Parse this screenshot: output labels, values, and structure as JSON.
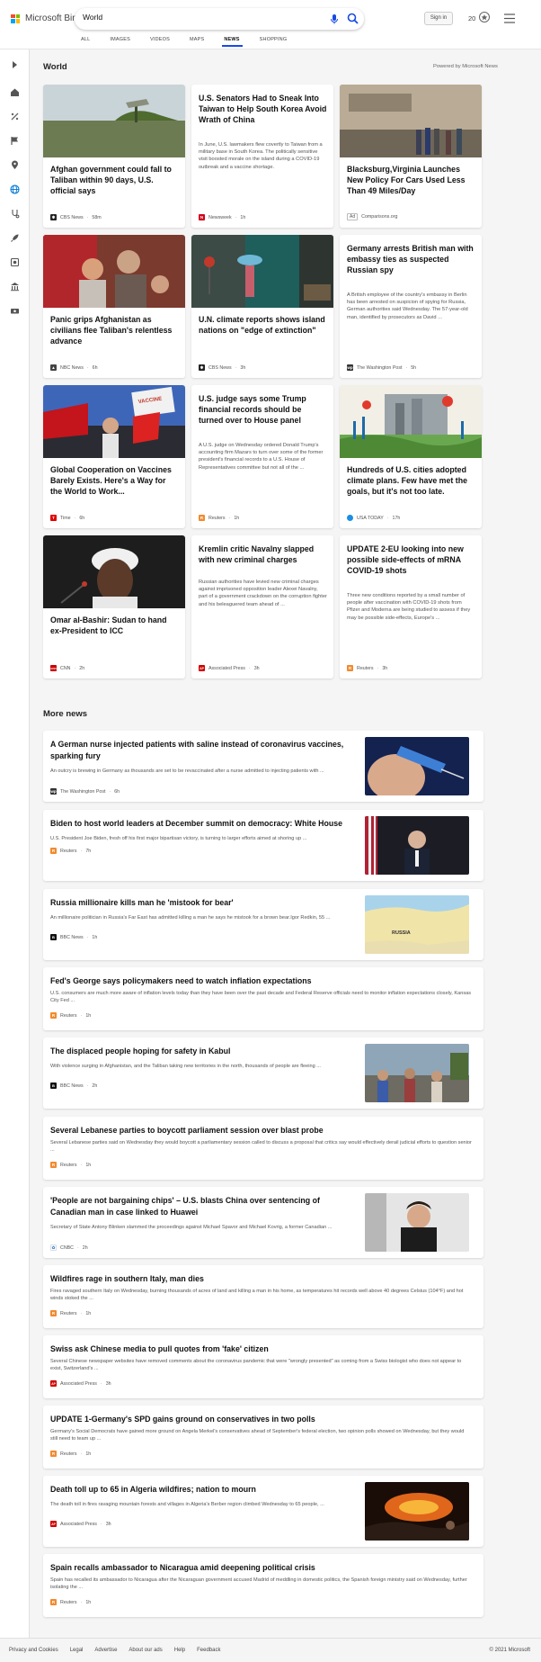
{
  "header": {
    "brand": "Microsoft Bing",
    "search_value": "World",
    "signin_label": "Sign in",
    "points": "20"
  },
  "tabs": [
    {
      "label": "ALL"
    },
    {
      "label": "IMAGES"
    },
    {
      "label": "VIDEOS"
    },
    {
      "label": "MAPS"
    },
    {
      "label": "NEWS"
    },
    {
      "label": "SHOPPING"
    }
  ],
  "world": {
    "title": "World",
    "powered_by": "Powered by Microsoft News"
  },
  "cards": [
    {
      "title": "Afghan government could fall to Taliban within 90 days, U.S. official says",
      "desc": "",
      "source": "CBS News",
      "time": "58m",
      "logo_color": "#222",
      "logo_text": "✱"
    },
    {
      "title": "U.S. Senators Had to Sneak Into Taiwan to Help South Korea Avoid Wrath of China",
      "desc": "In June, U.S. lawmakers flew covertly to Taiwan from a military base in South Korea. The politically sensitive visit boosted morale on the island during a COVID-19 outbreak and a vaccine shortage.",
      "source": "Newsweek",
      "time": "1h",
      "logo_color": "#d0021b",
      "logo_text": "N"
    },
    {
      "title": "Blacksburg,Virginia Launches New Policy For Cars Used Less Than 49 Miles/Day",
      "desc": "",
      "source": "Comparisons.org",
      "time": "",
      "ad": "Ad",
      "logo_color": "",
      "logo_text": ""
    },
    {
      "title": "Panic grips Afghanistan as civilians flee Taliban's relentless advance",
      "desc": "",
      "source": "NBC News",
      "time": "6h",
      "logo_color": "#444",
      "logo_text": "▲"
    },
    {
      "title": "U.N. climate reports shows island nations on \"edge of extinction\"",
      "desc": "",
      "source": "CBS News",
      "time": "3h",
      "logo_color": "#222",
      "logo_text": "✱"
    },
    {
      "title": "Germany arrests British man with embassy ties as suspected Russian spy",
      "desc": "A British employee of the country's embassy in Berlin has been arrested on suspicion of spying for Russia, German authorities said Wednesday. The 57-year-old man, identified by prosecutors as David ...",
      "source": "The Washington Post",
      "time": "5h",
      "logo_color": "#333",
      "logo_text": "wp"
    },
    {
      "title": "Global Cooperation on Vaccines Barely Exists. Here's a Way for the World to Work...",
      "desc": "",
      "source": "Time",
      "time": "6h",
      "logo_color": "#e10000",
      "logo_text": "T"
    },
    {
      "title": "U.S. judge says some Trump financial records should be turned over to House panel",
      "desc": "A U.S. judge on Wednesday ordered Donald Trump's accounting firm Mazars to turn over some of the former president's financial records to a U.S. House of Representatives committee but not all of the ...",
      "source": "Reuters",
      "time": "1h",
      "logo_color": "#f28a2e",
      "logo_text": "R"
    },
    {
      "title": "Hundreds of U.S. cities adopted climate plans. Few have met the goals, but it's not too late.",
      "desc": "",
      "source": "USA TODAY",
      "time": "17h",
      "logo_color": "#1a8fe3",
      "logo_text": ""
    },
    {
      "title": "Omar al-Bashir: Sudan to hand ex-President to ICC",
      "desc": "",
      "source": "CNN",
      "time": "2h",
      "logo_color": "#cc0000",
      "logo_text": "cnn"
    },
    {
      "title": "Kremlin critic Navalny slapped with new criminal charges",
      "desc": "Russian authorities have levied new criminal charges against imprisoned opposition leader Alexei Navalny, part of a government crackdown on the corruption fighter and his beleaguered team ahead of ...",
      "source": "Associated Press",
      "time": "3h",
      "logo_color": "#d10000",
      "logo_text": "AP"
    },
    {
      "title": "UPDATE 2-EU looking into new possible side-effects of mRNA COVID-19 shots",
      "desc": "Three new conditions reported by a small number of people after vaccination with COVID-19 shots from Pfizer and Moderna are being studied to assess if they may be possible side-effects, Europe's ...",
      "source": "Reuters",
      "time": "3h",
      "logo_color": "#f28a2e",
      "logo_text": "R"
    }
  ],
  "more_news": {
    "title": "More news",
    "rows": [
      {
        "title": "A German nurse injected patients with saline instead of coronavirus vaccines, sparking fury",
        "desc": "An outcry is brewing in Germany as thousands are set to be revaccinated after a nurse admitted to injecting patients with ...",
        "source": "The Washington Post",
        "time": "6h",
        "logo_color": "#333",
        "logo_text": "wp"
      },
      {
        "title": "Biden to host world leaders at December summit on democracy: White House",
        "desc": "U.S. President Joe Biden, fresh off his first major bipartisan victory, is turning to larger efforts aimed at shoring up ...",
        "source": "Reuters",
        "time": "7h",
        "logo_color": "#f28a2e",
        "logo_text": "R"
      },
      {
        "title": "Russia millionaire kills man he 'mistook for bear'",
        "desc": "An millionaire politician in Russia's Far East has admitted killing a man he says he mistook for a brown bear.Igor Redkin, 55 ...",
        "source": "BBC News",
        "time": "1h",
        "logo_color": "#111",
        "logo_text": "B",
        "map_label": "RUSSIA"
      },
      {
        "title": "Fed's George says policymakers need to watch inflation expectations",
        "desc": "U.S. consumers are much more aware of inflation levels today than they have been over the past decade and Federal Reserve officials need to monitor inflation expectations closely, Kansas City Fed ...",
        "source": "Reuters",
        "time": "1h",
        "logo_color": "#f28a2e",
        "logo_text": "R"
      },
      {
        "title": "The displaced people hoping for safety in Kabul",
        "desc": "With violence surging in Afghanistan, and the Taliban taking new territories in the north, thousands of people are fleeing ...",
        "source": "BBC News",
        "time": "2h",
        "logo_color": "#111",
        "logo_text": "B"
      },
      {
        "title": "Several Lebanese parties to boycott parliament session over blast probe",
        "desc": "Several Lebanese parties said on Wednesday they would boycott a parliamentary session called to discuss a proposal that critics say would effectively derail judicial efforts to question senior ...",
        "source": "Reuters",
        "time": "1h",
        "logo_color": "#f28a2e",
        "logo_text": "R"
      },
      {
        "title": "'People are not bargaining chips' – U.S. blasts China over sentencing of Canadian man in case linked to Huawei",
        "desc": "Secretary of State Antony Blinken slammed the proceedings against Michael Spavor and Michael Kovrig, a former Canadian ...",
        "source": "CNBC",
        "time": "2h",
        "logo_color": "#fff",
        "logo_text": "✿"
      },
      {
        "title": "Wildfires rage in southern Italy, man dies",
        "desc": "Fires ravaged southern Italy on Wednesday, burning thousands of acres of land and killing a man in his home, as temperatures hit records well above 40 degrees Celsius (104°F) and hot winds stoked the ...",
        "source": "Reuters",
        "time": "1h",
        "logo_color": "#f28a2e",
        "logo_text": "R"
      },
      {
        "title": "Swiss ask Chinese media to pull quotes from 'fake' citizen",
        "desc": "Several Chinese newspaper websites have removed comments about the coronavirus pandemic that were \"wrongly presented\" as coming from a Swiss biologist who does not appear to exist, Switzerland's ...",
        "source": "Associated Press",
        "time": "3h",
        "logo_color": "#d10000",
        "logo_text": "AP"
      },
      {
        "title": "UPDATE 1-Germany's SPD gains ground on conservatives in two polls",
        "desc": "Germany's Social Democrats have gained more ground on Angela Merkel's conservatives ahead of September's federal election, two opinion polls showed on Wednesday, but they would still need to team up ...",
        "source": "Reuters",
        "time": "1h",
        "logo_color": "#f28a2e",
        "logo_text": "R"
      },
      {
        "title": "Death toll up to 65 in Algeria wildfires; nation to mourn",
        "desc": "The death toll in fires ravaging mountain forests and villages in Algeria's Berber region climbed Wednesday to 65 people, ...",
        "source": "Associated Press",
        "time": "3h",
        "logo_color": "#d10000",
        "logo_text": "AP"
      },
      {
        "title": "Spain recalls ambassador to Nicaragua amid deepening political crisis",
        "desc": "Spain has recalled its ambassador to Nicaragua after the Nicaraguan government accused Madrid of meddling in domestic politics, the Spanish foreign ministry said on Wednesday, further isolating the ...",
        "source": "Reuters",
        "time": "1h",
        "logo_color": "#f28a2e",
        "logo_text": "R"
      }
    ]
  },
  "footer": {
    "links": [
      "Privacy and Cookies",
      "Legal",
      "Advertise",
      "About our ads",
      "Help",
      "Feedback"
    ],
    "copyright": "© 2021 Microsoft"
  }
}
